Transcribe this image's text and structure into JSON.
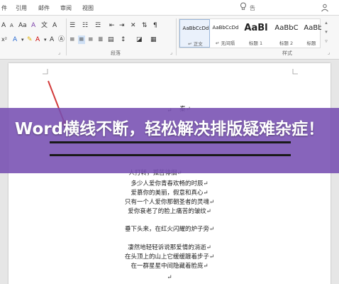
{
  "tabs": [
    "件",
    "引用",
    "邮件",
    "审阅",
    "视图"
  ],
  "tab_bar": {
    "lightbulb_icon": "lightbulb-icon",
    "search_text": "告",
    "share_icon": "share-icon"
  },
  "ribbon": {
    "paragraph_group_label": "段落",
    "styles_group_label": "样式",
    "styles": [
      {
        "sample": "AaBbCcDd",
        "name": "↵ 正文"
      },
      {
        "sample": "AaBbCcDd",
        "name": "↵ 无间隔"
      },
      {
        "sample": "AaBl",
        "name": "标题 1"
      },
      {
        "sample": "AaBbC",
        "name": "标题 2"
      },
      {
        "sample": "AaBbC",
        "name": "标题"
      }
    ]
  },
  "banner": {
    "title": "Word横线不断，轻松解决排版疑难杂症！"
  },
  "document": {
    "partial_lines": [
      "↵",
      "秦↵",
      "人打转，孤苦徘徊↵"
    ],
    "poem": [
      "多少人爱你青春欢畅的时辰↵",
      "爱慕你的美丽，假意和真心↵",
      "只有一个人爱你那朝圣者的灵魂↵",
      "爱你衰老了的脸上痛苦的皱纹↵",
      "",
      "垂下头来，在红火闪耀的炉子旁↵",
      "",
      "凄然地轻轻诉说那爱情的消逝↵",
      "在头顶上的山上它缓缓踱着步子↵",
      "在一群星星中间隐藏着脸庞↵",
      "↵"
    ]
  },
  "colors": {
    "banner": "#764eb2",
    "arrow": "#d23a3a"
  }
}
